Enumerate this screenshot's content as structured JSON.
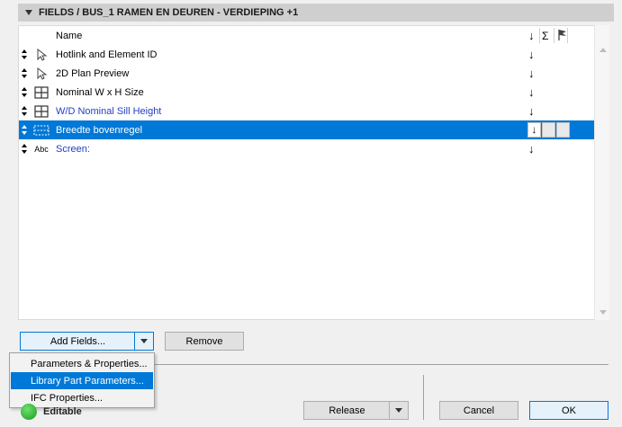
{
  "header": {
    "title": "FIELDS / BUS_1 RAMEN EN DEUREN - VERDIEPING +1"
  },
  "list": {
    "column_header": "Name",
    "sort_symbol": "↓",
    "sum_symbol": "Σ",
    "rows": [
      {
        "label": "Hotlink and Element ID",
        "icon": "cursor-arrow-icon",
        "blue": false
      },
      {
        "label": "2D Plan Preview",
        "icon": "cursor-arrow-icon",
        "blue": false
      },
      {
        "label": "Nominal W x H Size",
        "icon": "window-grid-icon",
        "blue": false
      },
      {
        "label": "W/D Nominal Sill Height",
        "icon": "window-grid-icon",
        "blue": true
      },
      {
        "label": "Breedte bovenregel",
        "icon": "dotted-frame-icon",
        "blue": false,
        "selected": true
      },
      {
        "label": "Screen:",
        "icon": "abc-text-icon",
        "icon_text": "Abc",
        "blue": true
      }
    ]
  },
  "buttons": {
    "add_fields": "Add Fields...",
    "remove": "Remove",
    "release": "Release",
    "cancel": "Cancel",
    "ok": "OK"
  },
  "menu": {
    "items": [
      {
        "label": "Parameters & Properties..."
      },
      {
        "label": "Library Part Parameters...",
        "highlighted": true
      },
      {
        "label": "IFC Properties..."
      }
    ]
  },
  "status": {
    "text": "Editable",
    "color": "#22aa22"
  },
  "colors": {
    "selection": "#0078d7",
    "blue_text": "#1f3fc7"
  }
}
